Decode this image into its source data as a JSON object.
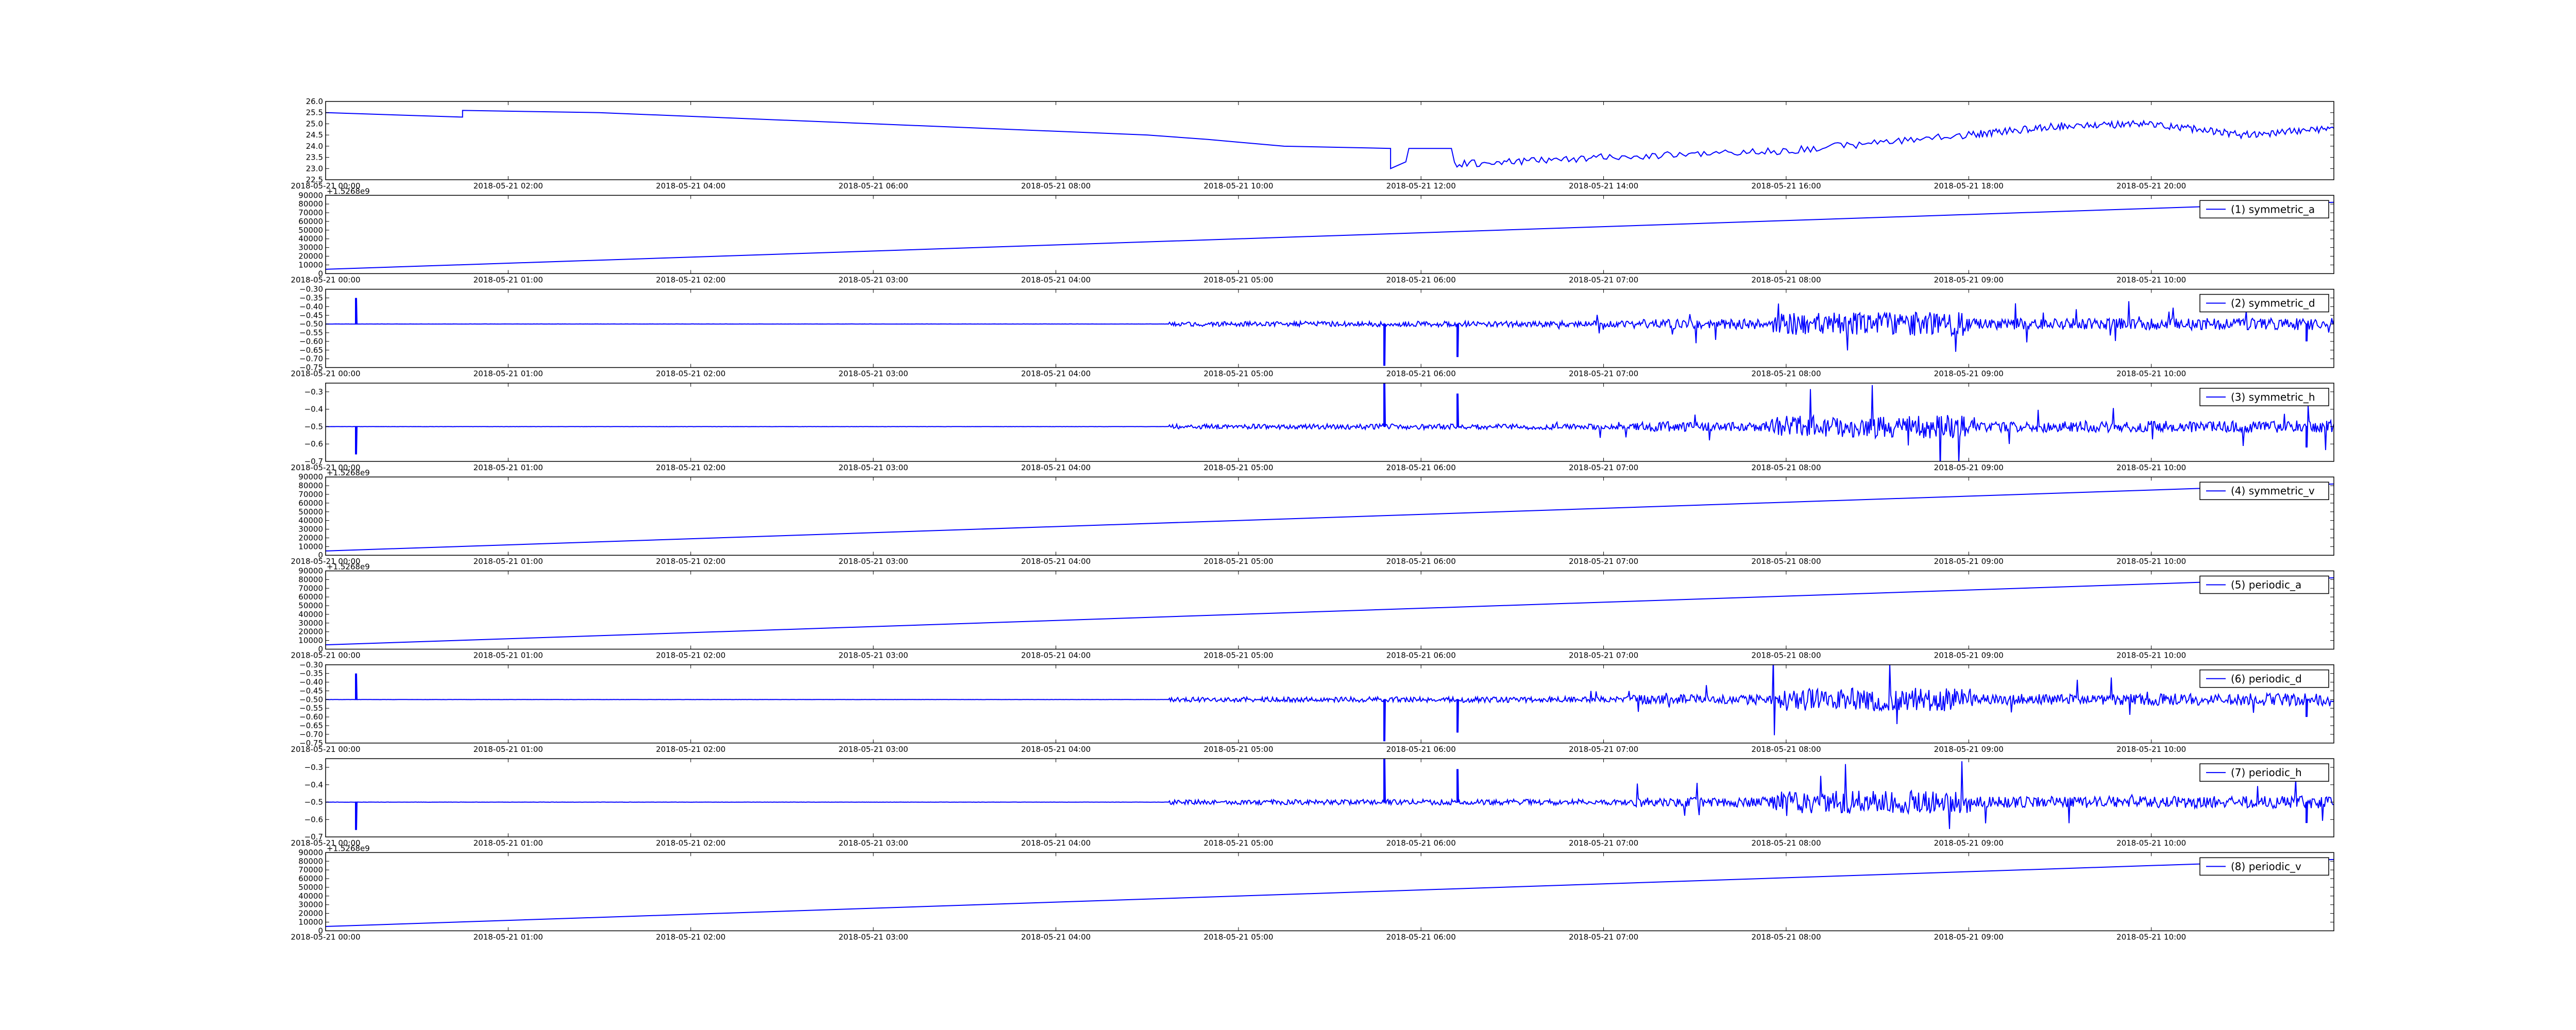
{
  "chart_data": [
    {
      "type": "line",
      "series": [
        {
          "shape": "temperature",
          "x": [
            "2018-05-21 00:00",
            "2018-05-21 01:30",
            "2018-05-21 01:30",
            "2018-05-21 03:00",
            "2018-05-21 06:00",
            "2018-05-21 09:00",
            "2018-05-21 09:40",
            "2018-05-21 10:30",
            "2018-05-21 11:40",
            "2018-05-21 11:40",
            "2018-05-21 11:50",
            "2018-05-21 11:52",
            "2018-05-21 12:20",
            "2018-05-21 12:22",
            "2018-05-21 14:00",
            "2018-05-21 16:00",
            "2018-05-21 18:00",
            "2018-05-21 19:00",
            "2018-05-21 20:00",
            "2018-05-21 21:00",
            "2018-05-21 22:00"
          ],
          "y": [
            25.5,
            25.3,
            25.6,
            25.5,
            25.0,
            24.5,
            24.3,
            24.0,
            23.9,
            23.0,
            23.3,
            23.9,
            23.9,
            23.2,
            23.5,
            23.8,
            24.5,
            24.9,
            25.0,
            24.5,
            24.8
          ],
          "color": "#0000ff"
        }
      ],
      "y_ticks": [
        "22.5",
        "23.0",
        "23.5",
        "24.0",
        "24.5",
        "25.0",
        "25.5",
        "26.0"
      ],
      "ylim": [
        22.5,
        26.0
      ],
      "x_ticks": [
        "2018-05-21 00:00",
        "2018-05-21 02:00",
        "2018-05-21 04:00",
        "2018-05-21 06:00",
        "2018-05-21 08:00",
        "2018-05-21 10:00",
        "2018-05-21 12:00",
        "2018-05-21 14:00",
        "2018-05-21 16:00",
        "2018-05-21 18:00",
        "2018-05-21 20:00"
      ],
      "xlim": [
        "2018-05-21 00:00",
        "2018-05-21 22:00"
      ]
    },
    {
      "type": "line",
      "series": [
        {
          "name": "(1) symmetric_a",
          "shape": "ramp",
          "y_start": 5000,
          "y_end": 82000,
          "color": "#0000ff"
        }
      ],
      "offset_text": "+1.5268e9",
      "y_ticks": [
        "0",
        "10000",
        "20000",
        "30000",
        "40000",
        "50000",
        "60000",
        "70000",
        "80000",
        "90000"
      ],
      "ylim": [
        0,
        90000
      ],
      "x_ticks": [
        "2018-05-21 00:00",
        "2018-05-21 01:00",
        "2018-05-21 02:00",
        "2018-05-21 03:00",
        "2018-05-21 04:00",
        "2018-05-21 05:00",
        "2018-05-21 06:00",
        "2018-05-21 07:00",
        "2018-05-21 08:00",
        "2018-05-21 09:00",
        "2018-05-21 10:00"
      ],
      "xlim": [
        "2018-05-21 00:00",
        "2018-05-21 11:00"
      ],
      "legend_position": "top-right"
    },
    {
      "type": "line",
      "series": [
        {
          "name": "(2) symmetric_d",
          "shape": "noise",
          "baseline": -0.5,
          "spikes": [
            {
              "x": "2018-05-21 00:10",
              "y": -0.35
            },
            {
              "x": "2018-05-21 05:48",
              "y": -0.74
            },
            {
              "x": "2018-05-21 06:12",
              "y": -0.69
            },
            {
              "x": "2018-05-21 10:51",
              "y": -0.6
            }
          ],
          "color": "#0000ff"
        }
      ],
      "y_ticks": [
        "-0.75",
        "-0.70",
        "-0.65",
        "-0.60",
        "-0.55",
        "-0.50",
        "-0.45",
        "-0.40",
        "-0.35",
        "-0.30"
      ],
      "ylim": [
        -0.75,
        -0.3
      ],
      "x_ticks": [
        "2018-05-21 00:00",
        "2018-05-21 01:00",
        "2018-05-21 02:00",
        "2018-05-21 03:00",
        "2018-05-21 04:00",
        "2018-05-21 05:00",
        "2018-05-21 06:00",
        "2018-05-21 07:00",
        "2018-05-21 08:00",
        "2018-05-21 09:00",
        "2018-05-21 10:00"
      ],
      "xlim": [
        "2018-05-21 00:00",
        "2018-05-21 11:00"
      ],
      "legend_position": "top-right"
    },
    {
      "type": "line",
      "series": [
        {
          "name": "(3) symmetric_h",
          "shape": "noise",
          "baseline": -0.5,
          "spikes": [
            {
              "x": "2018-05-21 00:10",
              "y": -0.66
            },
            {
              "x": "2018-05-21 05:48",
              "y": -0.25
            },
            {
              "x": "2018-05-21 06:12",
              "y": -0.31
            },
            {
              "x": "2018-05-21 10:51",
              "y": -0.62
            }
          ],
          "color": "#0000ff"
        }
      ],
      "y_ticks": [
        "-0.7",
        "-0.6",
        "-0.5",
        "-0.4",
        "-0.3"
      ],
      "ylim": [
        -0.7,
        -0.25
      ],
      "x_ticks": [
        "2018-05-21 00:00",
        "2018-05-21 01:00",
        "2018-05-21 02:00",
        "2018-05-21 03:00",
        "2018-05-21 04:00",
        "2018-05-21 05:00",
        "2018-05-21 06:00",
        "2018-05-21 07:00",
        "2018-05-21 08:00",
        "2018-05-21 09:00",
        "2018-05-21 10:00"
      ],
      "xlim": [
        "2018-05-21 00:00",
        "2018-05-21 11:00"
      ],
      "legend_position": "top-right"
    },
    {
      "type": "line",
      "series": [
        {
          "name": "(4) symmetric_v",
          "shape": "ramp",
          "y_start": 5000,
          "y_end": 82000,
          "color": "#0000ff"
        }
      ],
      "offset_text": "+1.5268e9",
      "y_ticks": [
        "0",
        "10000",
        "20000",
        "30000",
        "40000",
        "50000",
        "60000",
        "70000",
        "80000",
        "90000"
      ],
      "ylim": [
        0,
        90000
      ],
      "x_ticks": [
        "2018-05-21 00:00",
        "2018-05-21 01:00",
        "2018-05-21 02:00",
        "2018-05-21 03:00",
        "2018-05-21 04:00",
        "2018-05-21 05:00",
        "2018-05-21 06:00",
        "2018-05-21 07:00",
        "2018-05-21 08:00",
        "2018-05-21 09:00",
        "2018-05-21 10:00"
      ],
      "xlim": [
        "2018-05-21 00:00",
        "2018-05-21 11:00"
      ],
      "legend_position": "top-right"
    },
    {
      "type": "line",
      "series": [
        {
          "name": "(5) periodic_a",
          "shape": "ramp",
          "y_start": 5000,
          "y_end": 82000,
          "color": "#0000ff"
        }
      ],
      "offset_text": "+1.5268e9",
      "y_ticks": [
        "0",
        "10000",
        "20000",
        "30000",
        "40000",
        "50000",
        "60000",
        "70000",
        "80000",
        "90000"
      ],
      "ylim": [
        0,
        90000
      ],
      "x_ticks": [
        "2018-05-21 00:00",
        "2018-05-21 01:00",
        "2018-05-21 02:00",
        "2018-05-21 03:00",
        "2018-05-21 04:00",
        "2018-05-21 05:00",
        "2018-05-21 06:00",
        "2018-05-21 07:00",
        "2018-05-21 08:00",
        "2018-05-21 09:00",
        "2018-05-21 10:00"
      ],
      "xlim": [
        "2018-05-21 00:00",
        "2018-05-21 11:00"
      ],
      "legend_position": "top-right"
    },
    {
      "type": "line",
      "series": [
        {
          "name": "(6) periodic_d",
          "shape": "noise",
          "baseline": -0.5,
          "spikes": [
            {
              "x": "2018-05-21 00:10",
              "y": -0.35
            },
            {
              "x": "2018-05-21 05:48",
              "y": -0.74
            },
            {
              "x": "2018-05-21 06:12",
              "y": -0.69
            },
            {
              "x": "2018-05-21 10:51",
              "y": -0.6
            }
          ],
          "color": "#0000ff"
        }
      ],
      "y_ticks": [
        "-0.75",
        "-0.70",
        "-0.65",
        "-0.60",
        "-0.55",
        "-0.50",
        "-0.45",
        "-0.40",
        "-0.35",
        "-0.30"
      ],
      "ylim": [
        -0.75,
        -0.3
      ],
      "x_ticks": [
        "2018-05-21 00:00",
        "2018-05-21 01:00",
        "2018-05-21 02:00",
        "2018-05-21 03:00",
        "2018-05-21 04:00",
        "2018-05-21 05:00",
        "2018-05-21 06:00",
        "2018-05-21 07:00",
        "2018-05-21 08:00",
        "2018-05-21 09:00",
        "2018-05-21 10:00"
      ],
      "xlim": [
        "2018-05-21 00:00",
        "2018-05-21 11:00"
      ],
      "legend_position": "top-right"
    },
    {
      "type": "line",
      "series": [
        {
          "name": "(7) periodic_h",
          "shape": "noise",
          "baseline": -0.5,
          "spikes": [
            {
              "x": "2018-05-21 00:10",
              "y": -0.66
            },
            {
              "x": "2018-05-21 05:48",
              "y": -0.25
            },
            {
              "x": "2018-05-21 06:12",
              "y": -0.31
            },
            {
              "x": "2018-05-21 10:51",
              "y": -0.62
            }
          ],
          "color": "#0000ff"
        }
      ],
      "y_ticks": [
        "-0.7",
        "-0.6",
        "-0.5",
        "-0.4",
        "-0.3"
      ],
      "ylim": [
        -0.7,
        -0.25
      ],
      "x_ticks": [
        "2018-05-21 00:00",
        "2018-05-21 01:00",
        "2018-05-21 02:00",
        "2018-05-21 03:00",
        "2018-05-21 04:00",
        "2018-05-21 05:00",
        "2018-05-21 06:00",
        "2018-05-21 07:00",
        "2018-05-21 08:00",
        "2018-05-21 09:00",
        "2018-05-21 10:00"
      ],
      "xlim": [
        "2018-05-21 00:00",
        "2018-05-21 11:00"
      ],
      "legend_position": "top-right"
    },
    {
      "type": "line",
      "series": [
        {
          "name": "(8) periodic_v",
          "shape": "ramp",
          "y_start": 5000,
          "y_end": 82000,
          "color": "#0000ff"
        }
      ],
      "offset_text": "+1.5268e9",
      "y_ticks": [
        "0",
        "10000",
        "20000",
        "30000",
        "40000",
        "50000",
        "60000",
        "70000",
        "80000",
        "90000"
      ],
      "ylim": [
        0,
        90000
      ],
      "x_ticks": [
        "2018-05-21 00:00",
        "2018-05-21 01:00",
        "2018-05-21 02:00",
        "2018-05-21 03:00",
        "2018-05-21 04:00",
        "2018-05-21 05:00",
        "2018-05-21 06:00",
        "2018-05-21 07:00",
        "2018-05-21 08:00",
        "2018-05-21 09:00",
        "2018-05-21 10:00"
      ],
      "xlim": [
        "2018-05-21 00:00",
        "2018-05-21 11:00"
      ],
      "legend_position": "top-right"
    }
  ]
}
